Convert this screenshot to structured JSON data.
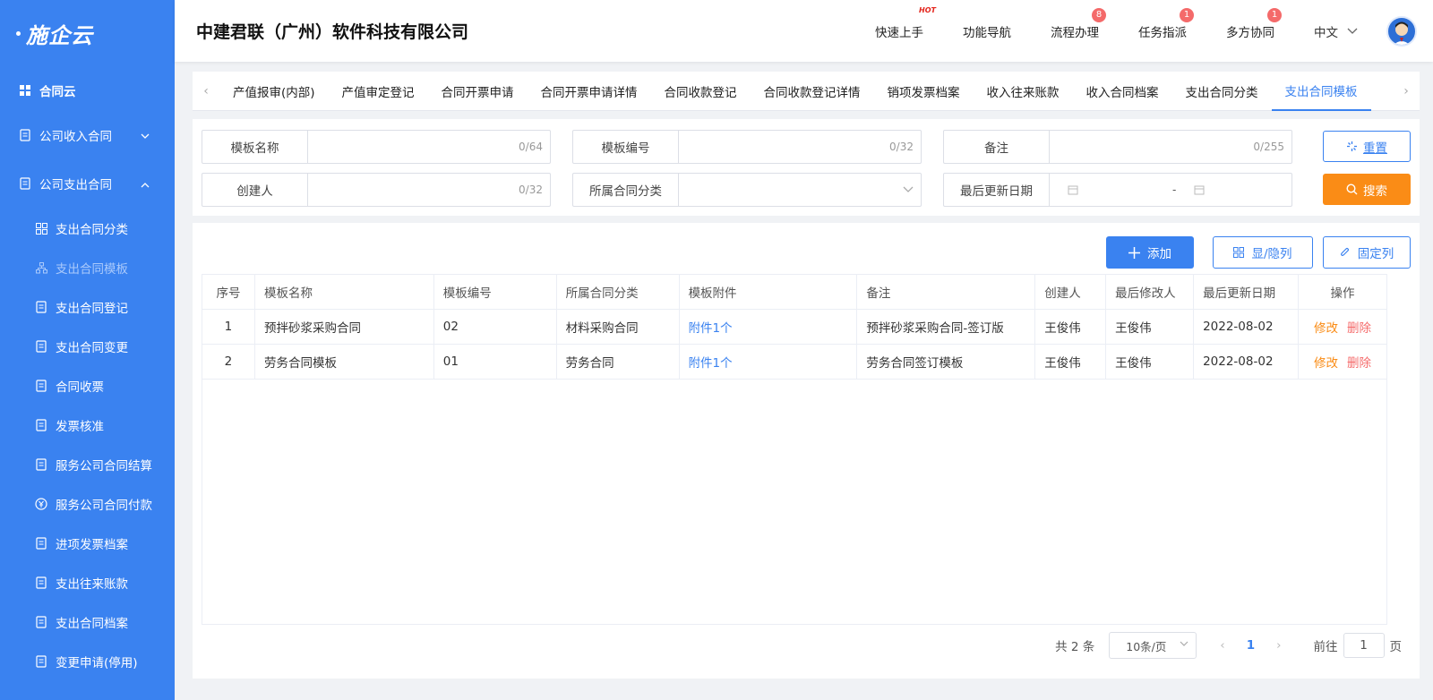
{
  "app": {
    "logo": "施企云"
  },
  "sidebar": {
    "items": [
      {
        "label": "合同云",
        "icon": "grid-icon",
        "level": "top"
      },
      {
        "label": "公司收入合同",
        "icon": "income-contract-icon",
        "level": "top",
        "expanded": false
      },
      {
        "label": "公司支出合同",
        "icon": "expense-contract-icon",
        "level": "top",
        "expanded": true
      },
      {
        "label": "支出合同分类",
        "icon": "category-icon",
        "level": "sub"
      },
      {
        "label": "支出合同模板",
        "icon": "template-icon",
        "level": "sub",
        "active": true
      },
      {
        "label": "支出合同登记",
        "icon": "register-icon",
        "level": "sub"
      },
      {
        "label": "支出合同变更",
        "icon": "change-icon",
        "level": "sub"
      },
      {
        "label": "合同收票",
        "icon": "receive-invoice-icon",
        "level": "sub"
      },
      {
        "label": "发票核准",
        "icon": "clipboard-icon",
        "level": "sub"
      },
      {
        "label": "服务公司合同结算",
        "icon": "coins-icon",
        "level": "sub"
      },
      {
        "label": "服务公司合同付款",
        "icon": "yen-icon",
        "level": "sub"
      },
      {
        "label": "进项发票档案",
        "icon": "invoice-archive-icon",
        "level": "sub"
      },
      {
        "label": "支出往来账款",
        "icon": "ledger-icon",
        "level": "sub"
      },
      {
        "label": "支出合同档案",
        "icon": "archive-check-icon",
        "level": "sub"
      },
      {
        "label": "变更申请(停用)",
        "icon": "request-icon",
        "level": "sub"
      }
    ]
  },
  "header": {
    "company": "中建君联（广州）软件科技有限公司",
    "nav": [
      {
        "label": "快速上手",
        "hot": "HOT"
      },
      {
        "label": "功能导航"
      },
      {
        "label": "流程办理",
        "badge": "8"
      },
      {
        "label": "任务指派",
        "badge": "1"
      },
      {
        "label": "多方协同",
        "badge": "1"
      }
    ],
    "language": "中文"
  },
  "tabs": [
    "产值报审(内部)",
    "产值审定登记",
    "合同开票申请",
    "合同开票申请详情",
    "合同收款登记",
    "合同收款登记详情",
    "销项发票档案",
    "收入往来账款",
    "收入合同档案",
    "支出合同分类",
    "支出合同模板"
  ],
  "active_tab": "支出合同模板",
  "filters": {
    "template_name": {
      "label": "模板名称",
      "counter": "0/64"
    },
    "template_code": {
      "label": "模板编号",
      "counter": "0/32"
    },
    "remark": {
      "label": "备注",
      "counter": "0/255"
    },
    "creator": {
      "label": "创建人",
      "counter": "0/32"
    },
    "category": {
      "label": "所属合同分类"
    },
    "updated": {
      "label": "最后更新日期",
      "separator": "-"
    },
    "reset_label": "重置",
    "search_label": "搜索"
  },
  "toolbar": {
    "add_label": "添加",
    "columns_label": "显/隐列",
    "fixed_label": "固定列"
  },
  "table": {
    "headers": [
      "序号",
      "模板名称",
      "模板编号",
      "所属合同分类",
      "模板附件",
      "备注",
      "创建人",
      "最后修改人",
      "最后更新日期",
      "操作"
    ],
    "rows": [
      {
        "no": "1",
        "name": "预拌砂浆采购合同",
        "code": "02",
        "category": "材料采购合同",
        "attachment": "附件1个",
        "remark": "预拌砂浆采购合同-签订版",
        "creator": "王俊伟",
        "modifier": "王俊伟",
        "updated": "2022-08-02",
        "edit": "修改",
        "delete": "删除"
      },
      {
        "no": "2",
        "name": "劳务合同模板",
        "code": "01",
        "category": "劳务合同",
        "attachment": "附件1个",
        "remark": "劳务合同签订模板",
        "creator": "王俊伟",
        "modifier": "王俊伟",
        "updated": "2022-08-02",
        "edit": "修改",
        "delete": "删除"
      }
    ]
  },
  "pagination": {
    "total": "共 2 条",
    "page_size": "10条/页",
    "current": "1",
    "goto_prefix": "前往",
    "goto_value": "1",
    "goto_suffix": "页"
  },
  "colors": {
    "primary": "#3a82f0",
    "accent": "#fa8c16",
    "danger": "#f56c6c",
    "badge": "#f46a6a"
  }
}
